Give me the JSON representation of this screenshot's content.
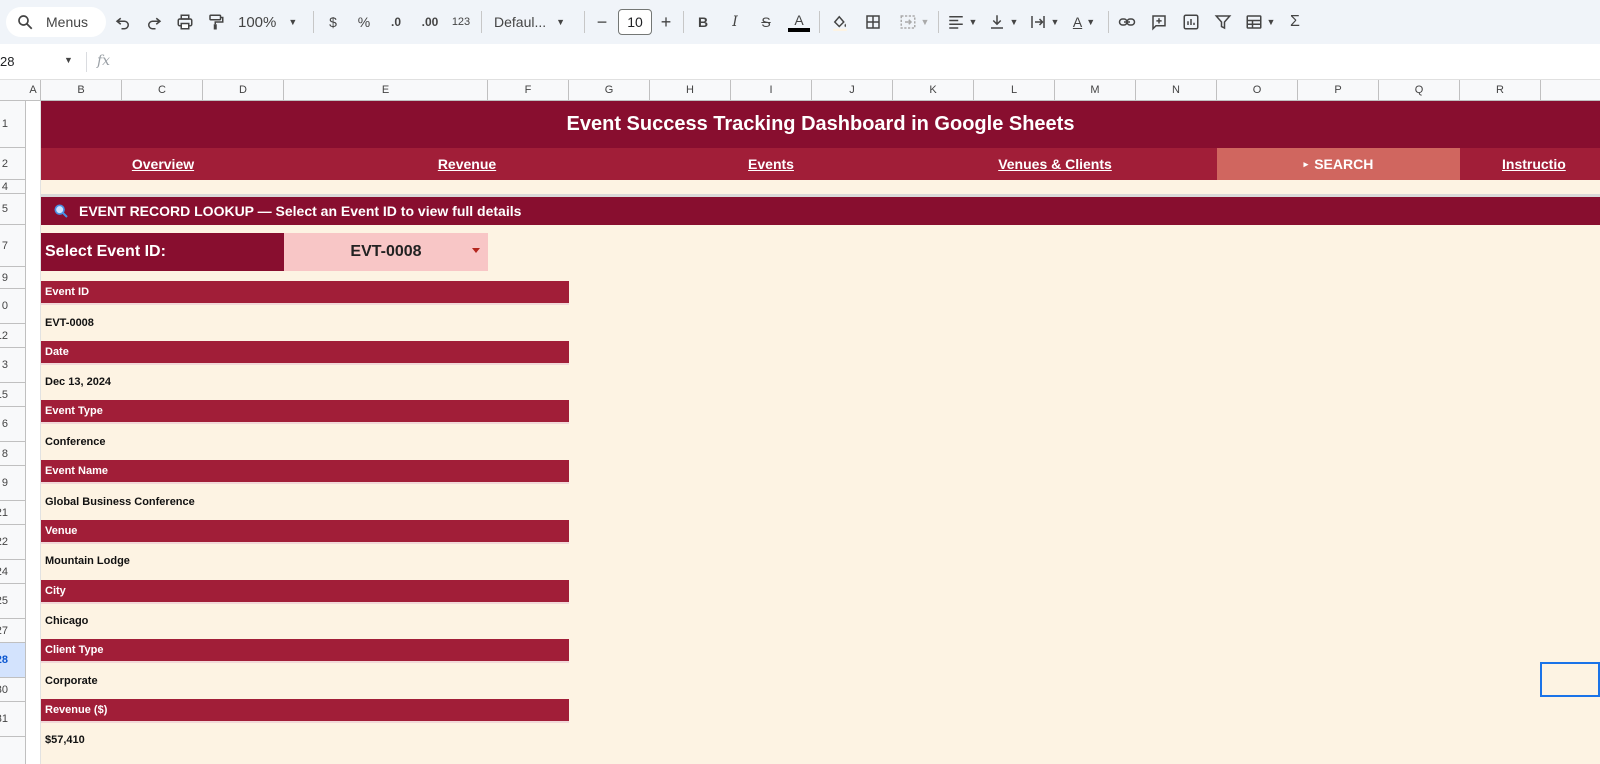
{
  "toolbar": {
    "search_label": "Menus",
    "zoom": "100%",
    "currency": "$",
    "percent": "%",
    "dec_decrease": ".0",
    "dec_increase": ".00",
    "number_format": "123",
    "font_name": "Defaul...",
    "minus": "−",
    "font_size": "10",
    "plus": "+",
    "bold": "B",
    "italic": "I",
    "strike": "S",
    "text_color": "A",
    "text_rotate": "A",
    "sum": "Σ"
  },
  "formula_bar": {
    "name_box": "28",
    "fx": "fx"
  },
  "columns": [
    "A",
    "B",
    "C",
    "D",
    "E",
    "F",
    "G",
    "H",
    "I",
    "J",
    "K",
    "L",
    "M",
    "N",
    "O",
    "P",
    "Q",
    "R"
  ],
  "rows": [
    "1",
    "2",
    "4",
    "5",
    "7",
    "9",
    "0",
    "12",
    "3",
    "15",
    "6",
    "8",
    "9",
    "21",
    "22",
    "24",
    "25",
    "27",
    "28",
    "30",
    "31"
  ],
  "dashboard": {
    "title": "Event Success Tracking Dashboard in Google Sheets",
    "nav": [
      {
        "label": "Overview"
      },
      {
        "label": "Revenue"
      },
      {
        "label": "Events"
      },
      {
        "label": "Venues & Clients"
      },
      {
        "label": "SEARCH",
        "prefix": "▸"
      },
      {
        "label": "Instructio"
      }
    ],
    "lookup_banner": "EVENT RECORD LOOKUP — Select an Event ID to view full details",
    "select_label": "Select Event ID:",
    "selected_event_id": "EVT-0008",
    "fields": [
      {
        "label": "Event ID",
        "value": "EVT-0008"
      },
      {
        "label": "Date",
        "value": "Dec 13, 2024"
      },
      {
        "label": "Event Type",
        "value": "Conference"
      },
      {
        "label": "Event Name",
        "value": "Global Business Conference"
      },
      {
        "label": "Venue",
        "value": "Mountain Lodge"
      },
      {
        "label": "City",
        "value": "Chicago"
      },
      {
        "label": "Client Type",
        "value": "Corporate"
      },
      {
        "label": "Revenue ($)",
        "value": "$57,410"
      }
    ]
  },
  "colors": {
    "title_bg": "#880e2f",
    "nav_bg": "#a11e38",
    "nav_active_bg": "#d0665f",
    "dropdown_bg": "#f8c6c6",
    "sheet_bg": "#fdf3e3"
  }
}
